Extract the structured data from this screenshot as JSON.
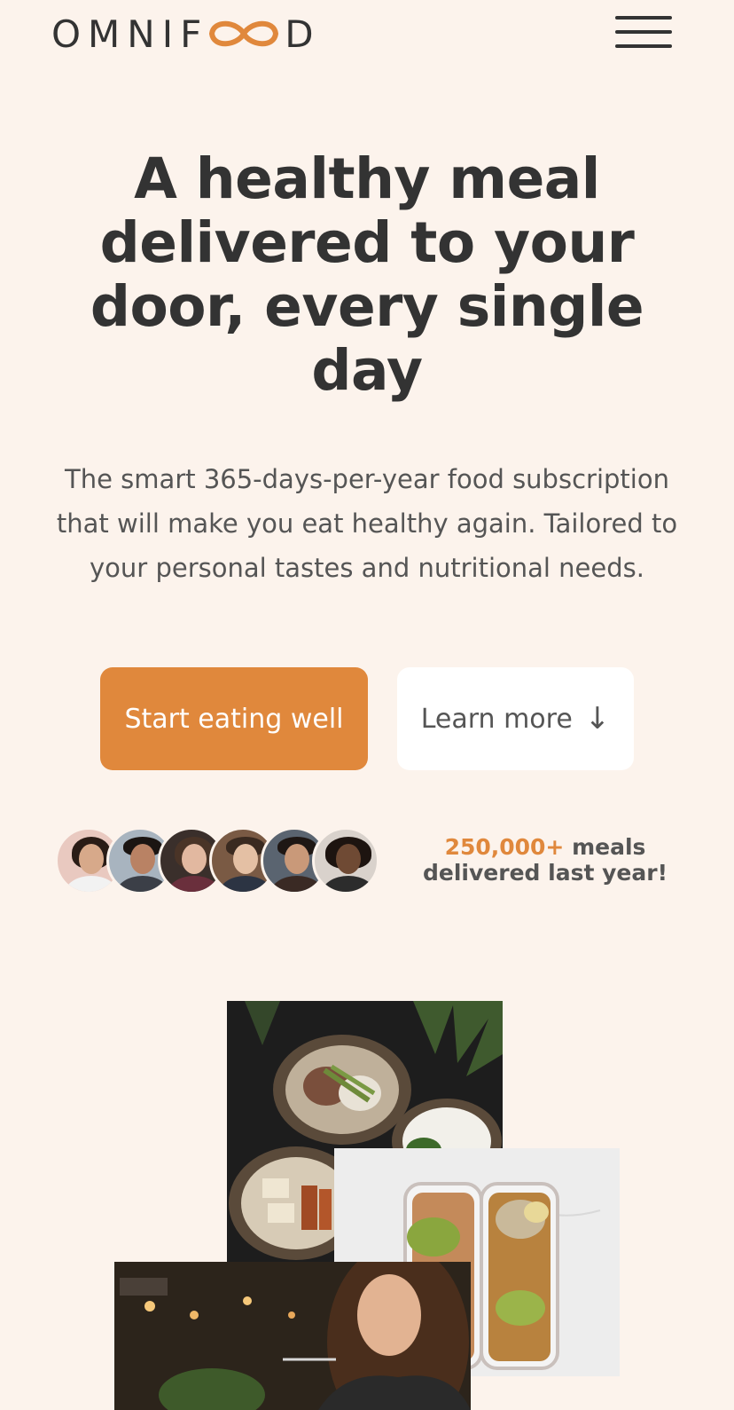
{
  "header": {
    "logo_prefix": "OMNIF",
    "logo_suffix": "D",
    "brand_color": "#e0883c"
  },
  "hero": {
    "title": "A healthy meal delivered to your door, every single day",
    "description": "The smart 365-days-per-year food subscription that will make you eat healthy again. Tailored to your personal tastes and nutritional needs."
  },
  "buttons": {
    "primary_label": "Start eating well",
    "secondary_label": "Learn more",
    "secondary_icon": "↓"
  },
  "customers": {
    "count": "250,000+",
    "rest": " meals delivered last year!"
  },
  "colors": {
    "background": "#fcf3ec",
    "accent": "#e0883c",
    "text_dark": "#333333",
    "text_body": "#555555"
  }
}
